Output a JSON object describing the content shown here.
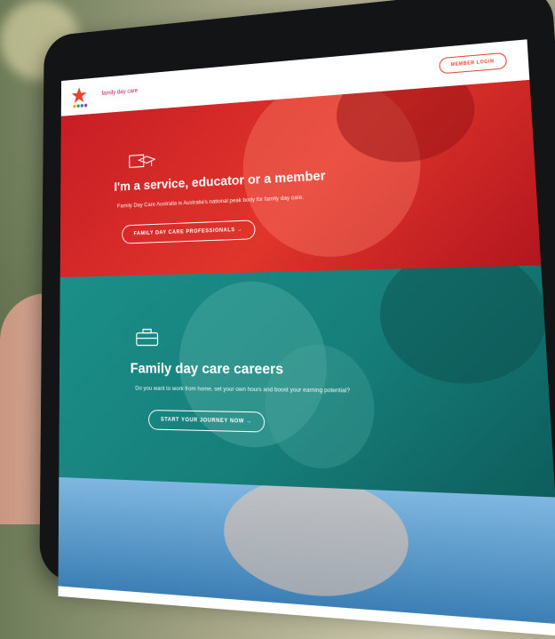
{
  "header": {
    "brand_text": "family day care",
    "login_label": "MEMBER LOGIN"
  },
  "panels": [
    {
      "heading": "I'm a service, educator or a member",
      "subtext": "Family Day Care Australia is Australia's national peak body for family day care.",
      "cta_label": "FAMILY DAY CARE PROFESSIONALS →",
      "icon": "graduation-cap-icon",
      "color": "#d62a2a"
    },
    {
      "heading": "Family day care careers",
      "subtext": "Do you want to work from home, set your own hours and boost your earning potential?",
      "cta_label": "START YOUR JOURNEY NOW →",
      "icon": "briefcase-icon",
      "color": "#17857f"
    }
  ]
}
